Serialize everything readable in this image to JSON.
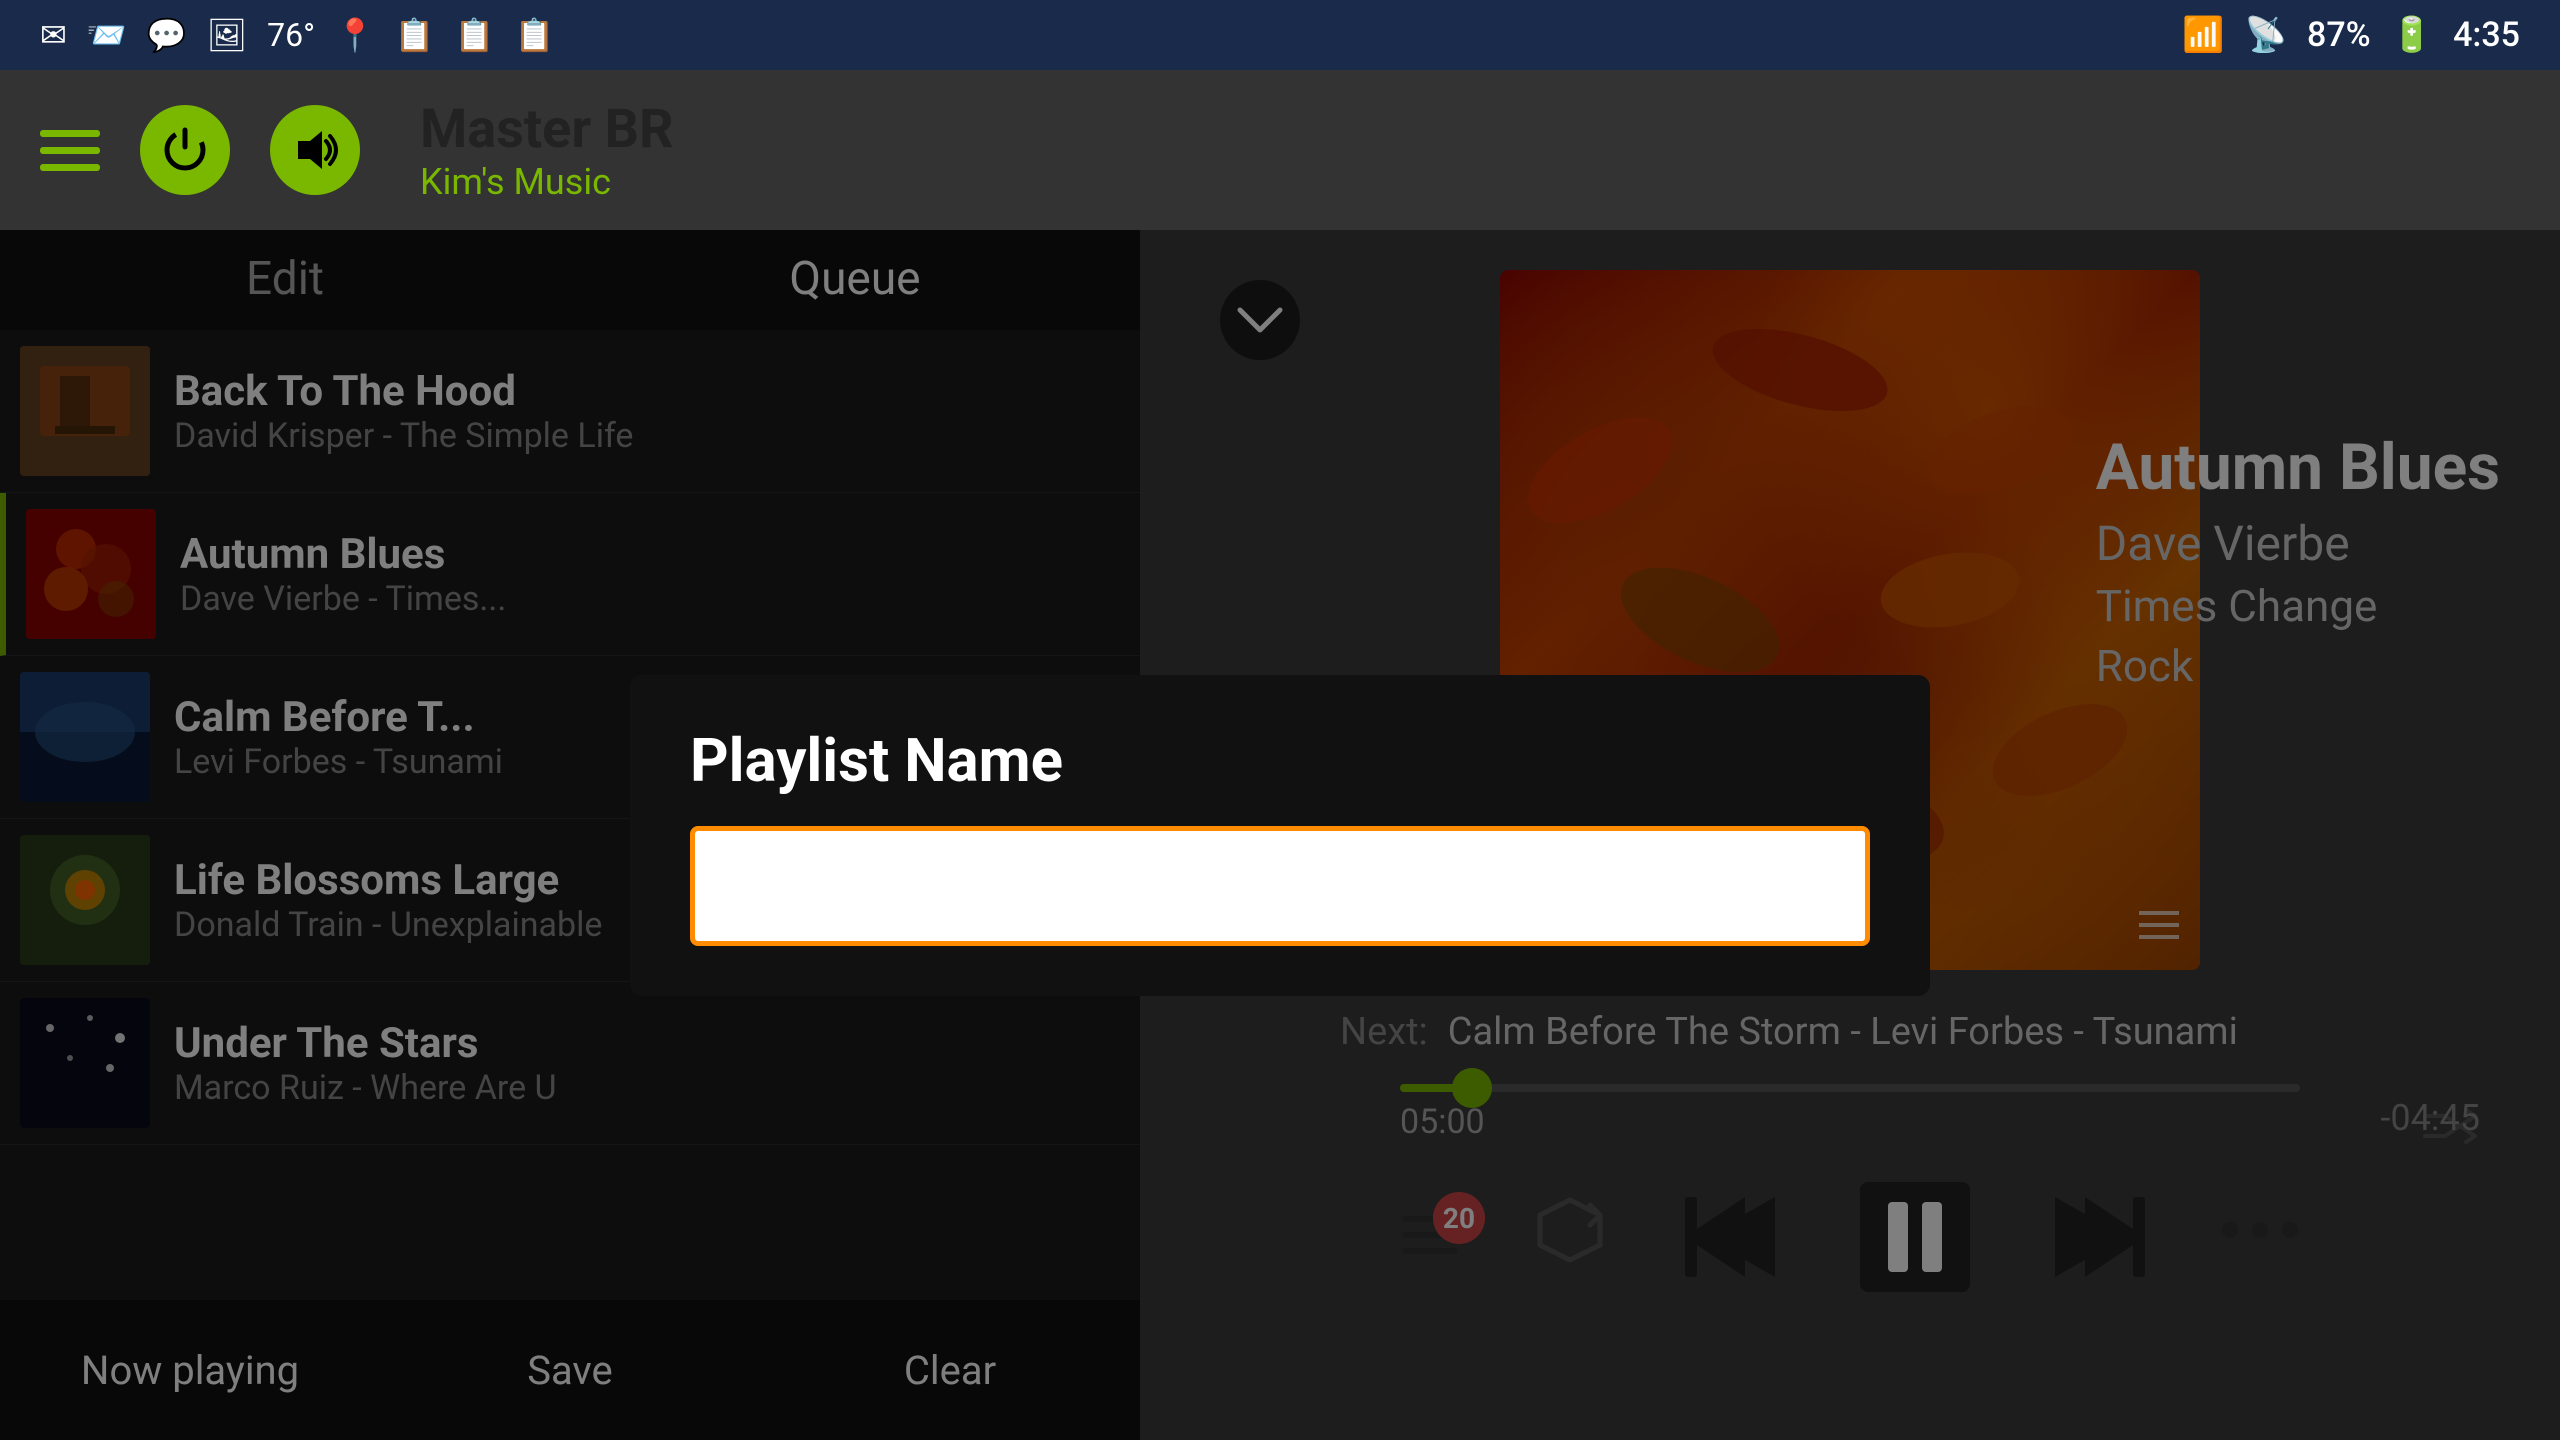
{
  "statusBar": {
    "temperature": "76°",
    "battery": "87%",
    "time": "4:35"
  },
  "header": {
    "title": "Master BR",
    "subtitle": "Kim's Music",
    "hamburgerLabel": "Menu",
    "powerLabel": "Power",
    "speakerLabel": "Speaker"
  },
  "playlistTabs": {
    "edit": "Edit",
    "queue": "Queue"
  },
  "songs": [
    {
      "title": "Back To The Hood",
      "artist": "David Krisper",
      "album": "The Simple Life",
      "thumbClass": "thumb-back-to-hood",
      "active": false
    },
    {
      "title": "Autumn Blues",
      "artist": "Dave Vierbe",
      "album": "Times Change",
      "thumbClass": "thumb-autumn-blues",
      "active": true
    },
    {
      "title": "Calm Before T...",
      "artist": "Levi Forbes",
      "album": "Tsunami",
      "thumbClass": "thumb-calm-before",
      "active": false
    },
    {
      "title": "Life Blossoms Large",
      "artist": "Donald Train",
      "album": "Unexplainable",
      "thumbClass": "thumb-life-blossoms",
      "active": false
    },
    {
      "title": "Under The Stars",
      "artist": "Marco Ruiz",
      "album": "Where Are U",
      "thumbClass": "thumb-under-stars",
      "active": false
    }
  ],
  "bottomBar": {
    "nowPlaying": "Now playing",
    "save": "Save",
    "clear": "Clear"
  },
  "player": {
    "currentSongTitle": "Autumn Blues",
    "currentSongArtist": "Dave Vierbe",
    "currentSongAlbum": "Times Change",
    "currentSongGenre": "Rock",
    "nextLabel": "Next:",
    "nextTrack": "Calm Before The Storm - Levi Forbes - Tsunami",
    "timeElapsed": "05:00",
    "timeRemaining": "-04:45",
    "queueCount": "20",
    "progressPercent": 8
  },
  "modal": {
    "title": "Playlist Name",
    "inputPlaceholder": "",
    "inputValue": ""
  },
  "controls": {
    "prevLabel": "Previous",
    "pauseLabel": "Pause",
    "nextLabel": "Next",
    "repeatLabel": "Repeat",
    "moreLabel": "More options"
  }
}
